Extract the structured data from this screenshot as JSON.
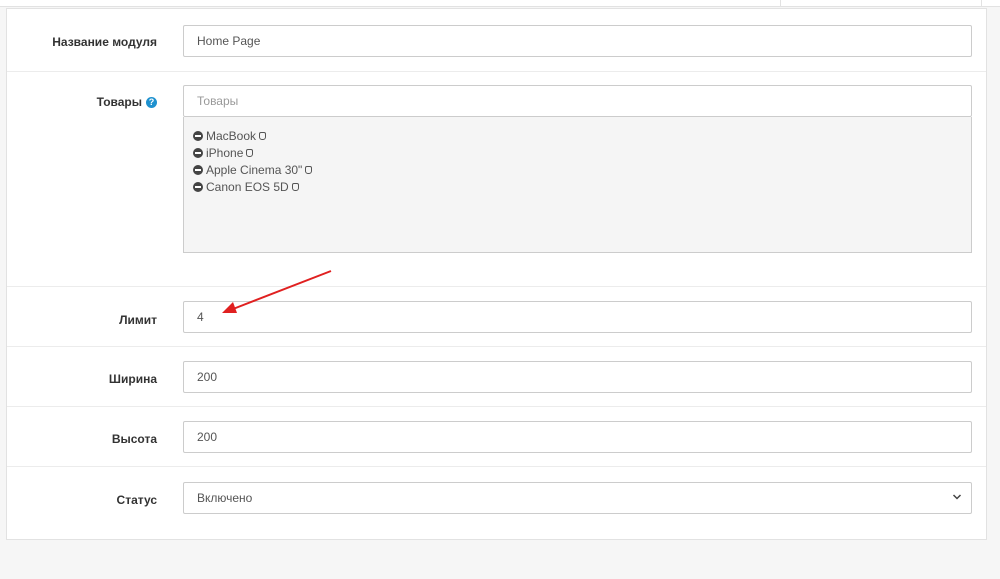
{
  "form": {
    "module_name": {
      "label": "Название модуля",
      "value": "Home Page"
    },
    "products": {
      "label": "Товары",
      "placeholder": "Товары",
      "items": [
        {
          "name": "MacBook"
        },
        {
          "name": "iPhone"
        },
        {
          "name": "Apple Cinema 30\""
        },
        {
          "name": "Canon EOS 5D"
        }
      ]
    },
    "limit": {
      "label": "Лимит",
      "value": "4"
    },
    "width": {
      "label": "Ширина",
      "value": "200"
    },
    "height": {
      "label": "Высота",
      "value": "200"
    },
    "status": {
      "label": "Статус",
      "value": "Включено"
    }
  },
  "colors": {
    "help_icon": "#1e91cf",
    "annotation_arrow": "#e02020"
  },
  "icons": {
    "help": "question-circle-icon",
    "remove": "minus-circle-icon",
    "drag": "drag-handle-icon",
    "dropdown": "chevron-down-icon"
  }
}
